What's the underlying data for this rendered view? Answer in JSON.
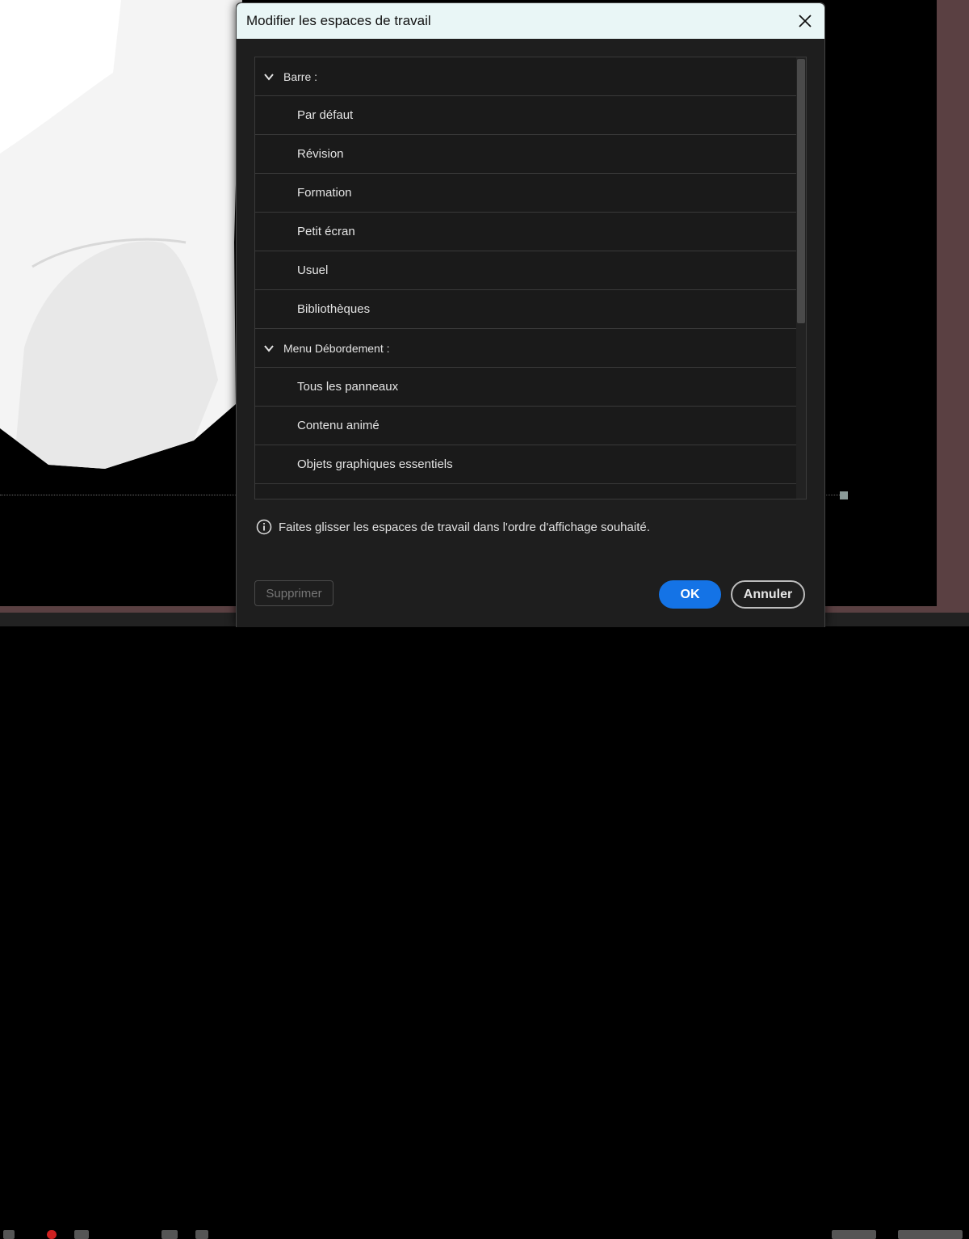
{
  "dialog": {
    "title": "Modifier les espaces de travail",
    "close_icon": "close-icon",
    "groups": [
      {
        "label": "Barre :",
        "items": [
          "Par défaut",
          "Révision",
          "Formation",
          "Petit écran",
          "Usuel",
          "Bibliothèques"
        ]
      },
      {
        "label": "Menu Débordement :",
        "items": [
          "Tous les panneaux",
          "Contenu animé",
          "Objets graphiques essentiels",
          ""
        ]
      }
    ],
    "info_text": "Faites glisser les espaces de travail dans l'ordre d'affichage souhaité.",
    "info_icon": "info-icon",
    "buttons": {
      "delete": "Supprimer",
      "ok": "OK",
      "cancel": "Annuler"
    }
  },
  "colors": {
    "accent": "#1473e6",
    "titlebar": "#e9f6f6",
    "dialog_bg": "#1e1e1e",
    "background_panel": "#5a4042"
  }
}
